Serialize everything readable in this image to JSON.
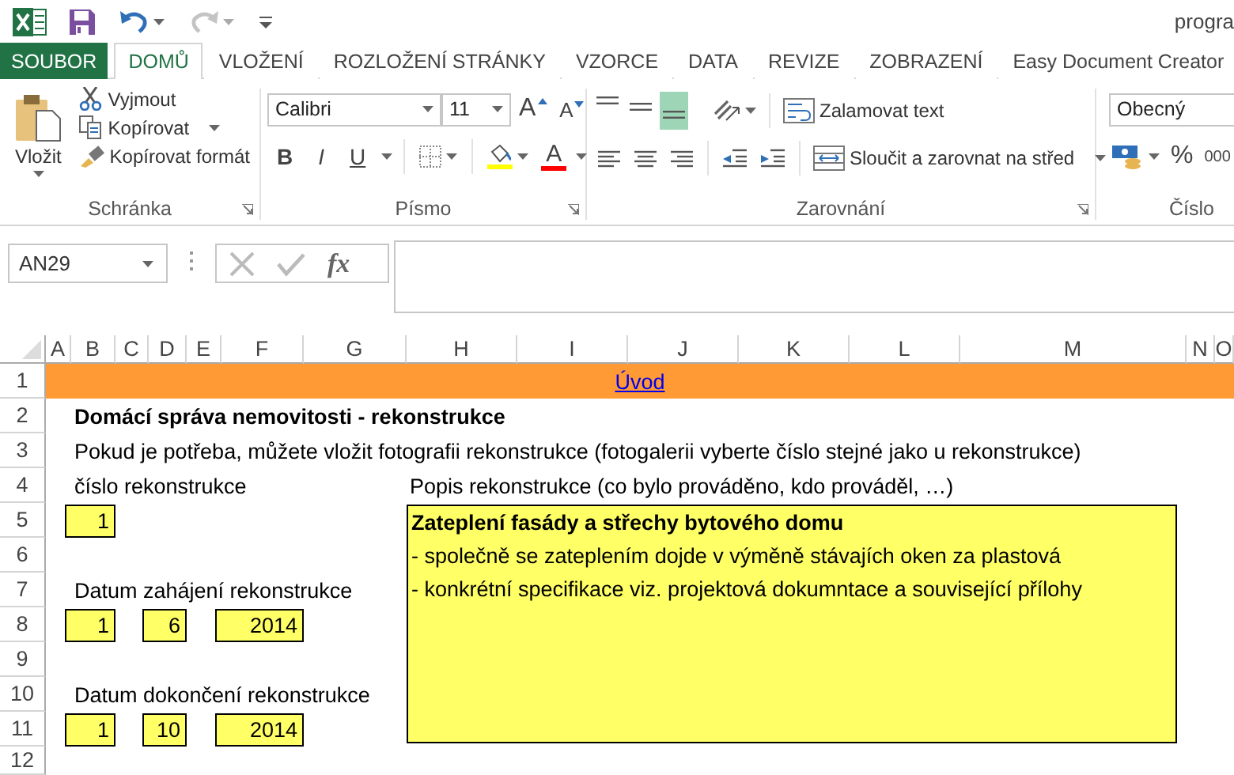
{
  "title_bar": {
    "title": "progra",
    "quick_access": [
      {
        "kind": "save",
        "disabled": false
      },
      {
        "kind": "undo",
        "disabled": false
      },
      {
        "kind": "redo",
        "disabled": true
      }
    ]
  },
  "tabs": [
    {
      "label": "SOUBOR",
      "kind": "file",
      "selected": false
    },
    {
      "label": "DOMŮ",
      "kind": "tab",
      "selected": true
    },
    {
      "label": "VLOŽENÍ",
      "kind": "tab",
      "selected": false
    },
    {
      "label": "ROZLOŽENÍ STRÁNKY",
      "kind": "tab",
      "selected": false
    },
    {
      "label": "VZORCE",
      "kind": "tab",
      "selected": false
    },
    {
      "label": "DATA",
      "kind": "tab",
      "selected": false
    },
    {
      "label": "REVIZE",
      "kind": "tab",
      "selected": false
    },
    {
      "label": "ZOBRAZENÍ",
      "kind": "tab",
      "selected": false
    },
    {
      "label": "Easy Document Creator",
      "kind": "tab",
      "selected": false
    }
  ],
  "ribbon": {
    "clipboard": {
      "label": "Schránka",
      "paste": "Vložit",
      "actions": [
        {
          "kind": "cut",
          "label": "Vyjmout"
        },
        {
          "kind": "copy",
          "label": "Kopírovat"
        },
        {
          "kind": "format",
          "label": "Kopírovat formát"
        }
      ]
    },
    "font": {
      "label": "Písmo",
      "font_name": "Calibri",
      "font_size": "11",
      "size_buttons": [
        {
          "kind": "grow",
          "label": "A"
        },
        {
          "kind": "shrink",
          "label": "A"
        }
      ],
      "style_buttons": [
        {
          "kind": "bold",
          "label": "B"
        },
        {
          "kind": "italic",
          "label": "I"
        },
        {
          "kind": "underline",
          "label": "U"
        }
      ],
      "color_buttons": [
        {
          "kind": "fill",
          "color": "#ffff00"
        },
        {
          "kind": "text",
          "label": "A",
          "color": "#ff0000"
        }
      ]
    },
    "alignment": {
      "label": "Zarovnání",
      "vertical": [
        {
          "selected": false
        },
        {
          "selected": false
        },
        {
          "selected": true
        }
      ],
      "wrap": "Zalamovat text",
      "merge": "Sloučit a zarovnat na střed"
    },
    "number": {
      "label": "Číslo",
      "format": "Obecný",
      "percent": "%",
      "thousands": "000"
    }
  },
  "formula_bar": {
    "name_box": "AN29",
    "function_button": "fx"
  },
  "sheet": {
    "columns": [
      "A",
      "B",
      "C",
      "D",
      "E",
      "F",
      "G",
      "H",
      "I",
      "J",
      "K",
      "L",
      "M",
      "N",
      "O"
    ],
    "rows": [
      {
        "number": "1",
        "cells": [
          {
            "kind": "banner",
            "text": "Úvod"
          }
        ]
      },
      {
        "number": "2",
        "cells": [
          {
            "kind": "title",
            "text": "Domácí správa nemovitosti - rekonstrukce"
          }
        ]
      },
      {
        "number": "3",
        "cells": [
          {
            "kind": "text",
            "text": "Pokud je potřeba, můžete vložit fotografii rekonstrukce (fotogalerii vyberte číslo stejné jako u rekonstrukce)"
          }
        ]
      },
      {
        "number": "4",
        "cells": [
          {
            "kind": "text",
            "text": "číslo rekonstrukce"
          },
          {
            "kind": "text",
            "text": "Popis rekonstrukce (co bylo prováděno, kdo prováděl, …)"
          }
        ]
      },
      {
        "number": "5",
        "cells": [
          {
            "kind": "input",
            "text": "1"
          }
        ]
      },
      {
        "number": "6"
      },
      {
        "number": "7",
        "cells": [
          {
            "kind": "text",
            "text": "Datum zahájení rekonstrukce"
          }
        ]
      },
      {
        "number": "8",
        "cells": [
          {
            "kind": "input",
            "text": "1"
          },
          {
            "kind": "input",
            "text": "6"
          },
          {
            "kind": "input",
            "text": "2014"
          }
        ]
      },
      {
        "number": "9"
      },
      {
        "number": "10",
        "cells": [
          {
            "kind": "text",
            "text": "Datum dokončení rekonstrukce"
          }
        ]
      },
      {
        "number": "11",
        "cells": [
          {
            "kind": "input",
            "text": "1"
          },
          {
            "kind": "input",
            "text": "10"
          },
          {
            "kind": "input",
            "text": "2014"
          }
        ]
      },
      {
        "number": "12"
      }
    ],
    "description": {
      "lines": [
        {
          "text": "Zateplení fasády a střechy bytového domu",
          "bold": true
        },
        {
          "text": "- společně se zateplením dojde v výměně stávajích oken za plastová",
          "bold": false
        },
        {
          "text": "- konkrétní specifikace viz. projektová dokumntace a související přílohy",
          "bold": false
        }
      ]
    }
  }
}
